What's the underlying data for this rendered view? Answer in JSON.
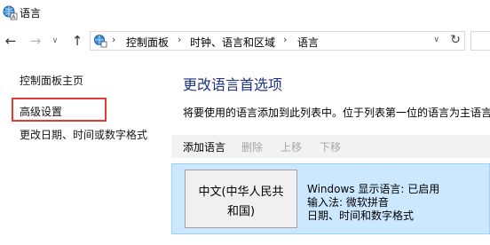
{
  "window": {
    "title": "语言"
  },
  "nav": {
    "back_icon": "arrow-left-icon",
    "forward_icon": "arrow-right-icon",
    "recent_icon": "chevron-down-icon",
    "up_icon": "arrow-up-icon"
  },
  "address": {
    "breadcrumbs": [
      "控制面板",
      "时钟、语言和区域",
      "语言"
    ],
    "separator": "›",
    "refresh_icon": "refresh-icon"
  },
  "sidebar": {
    "items": [
      {
        "label": "控制面板主页"
      },
      {
        "label": "高级设置",
        "highlighted": true
      },
      {
        "label": "更改日期、时间或数字格式"
      }
    ]
  },
  "main": {
    "title": "更改语言首选项",
    "description": "将要使用的语言添加到此列表中。位于列表第一位的语言为主语言"
  },
  "toolbar": {
    "add_label": "添加语言",
    "delete_label": "删除",
    "move_up_label": "上移",
    "move_down_label": "下移"
  },
  "languages": [
    {
      "name_line1": "中文(中华人民共",
      "name_line2": "和国)",
      "display_status": "Windows 显示语言: 已启用",
      "input_method": "输入法: 微软拼音",
      "format_label": "日期、时间和数字格式"
    }
  ],
  "colors": {
    "accent_title": "#1e3287",
    "selection_bg": "#cce8ff",
    "selection_border": "#99d1ff",
    "highlight_box": "#e53935",
    "disabled_text": "#a6a6a6"
  }
}
